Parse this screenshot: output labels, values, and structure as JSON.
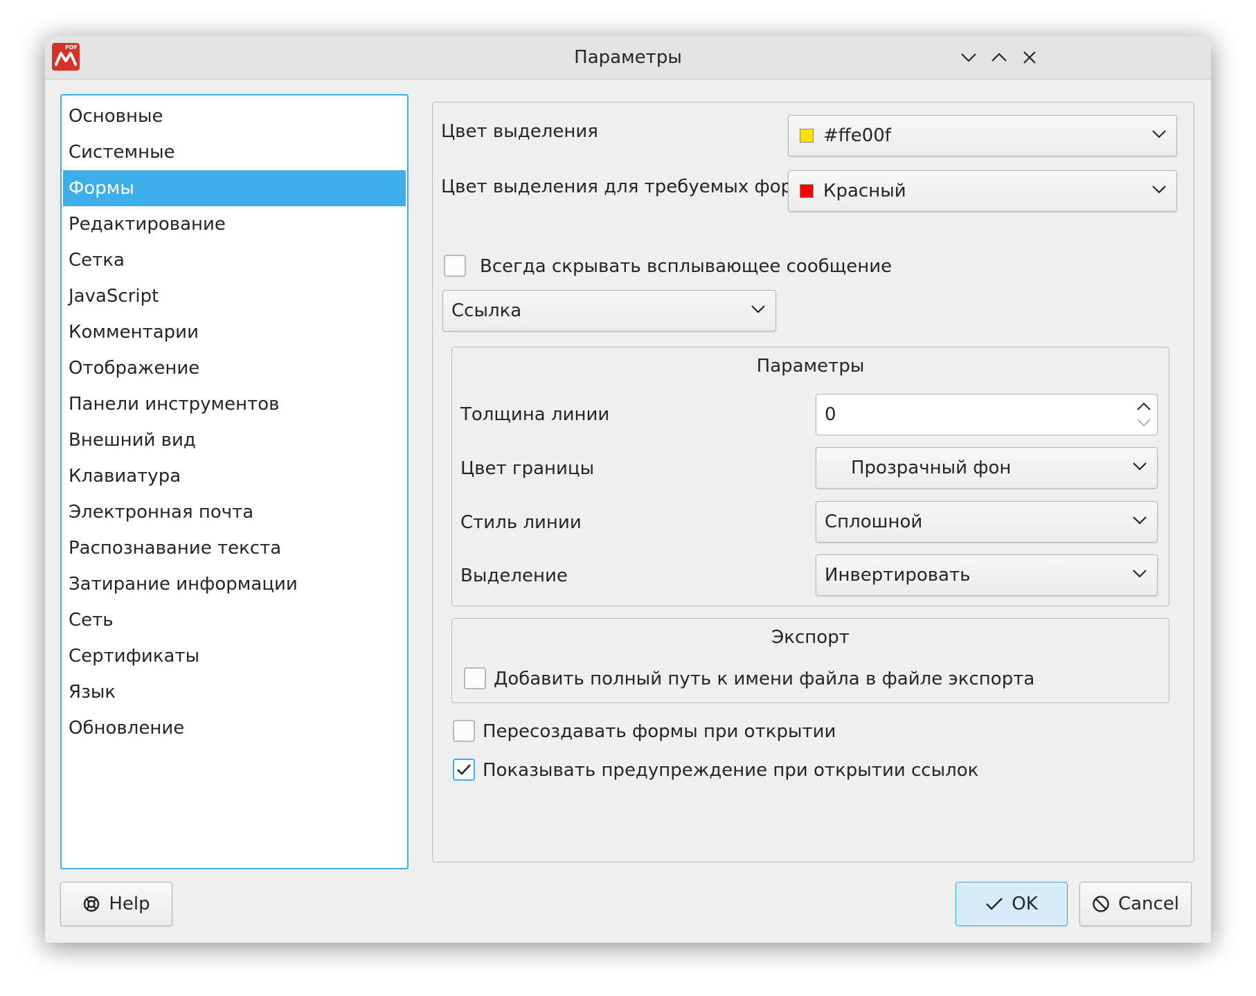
{
  "window": {
    "title": "Параметры"
  },
  "sidebar": {
    "items": [
      {
        "label": "Основные"
      },
      {
        "label": "Системные"
      },
      {
        "label": "Формы",
        "selected": true
      },
      {
        "label": "Редактирование"
      },
      {
        "label": "Сетка"
      },
      {
        "label": "JavaScript"
      },
      {
        "label": "Комментарии"
      },
      {
        "label": "Отображение"
      },
      {
        "label": "Панели инструментов"
      },
      {
        "label": "Внешний вид"
      },
      {
        "label": "Клавиатура"
      },
      {
        "label": "Электронная почта"
      },
      {
        "label": "Распознавание текста"
      },
      {
        "label": "Затирание информации"
      },
      {
        "label": "Сеть"
      },
      {
        "label": "Сертификаты"
      },
      {
        "label": "Язык"
      },
      {
        "label": "Обновление"
      }
    ]
  },
  "forms": {
    "highlight_color": {
      "label": "Цвет выделения",
      "value": "#ffe00f",
      "swatch": "#ffe00f"
    },
    "required_color": {
      "label": "Цвет выделения для требуемых форм",
      "value": "Красный",
      "swatch": "#ff0000"
    },
    "hide_popup": {
      "label": "Всегда скрывать всплывающее сообщение",
      "checked": false
    },
    "field_type": {
      "value": "Ссылка"
    },
    "params_group": {
      "title": "Параметры",
      "line_width": {
        "label": "Толщина линии",
        "value": "0"
      },
      "border_color": {
        "label": "Цвет границы",
        "value": "Прозрачный фон"
      },
      "line_style": {
        "label": "Стиль линии",
        "value": "Сплошной"
      },
      "highlight": {
        "label": "Выделение",
        "value": "Инвертировать"
      }
    },
    "export_group": {
      "title": "Экспорт",
      "add_path": {
        "label": "Добавить полный путь к имени файла в файле экспорта",
        "checked": false
      }
    },
    "recreate_forms": {
      "label": "Пересоздавать формы при открытии",
      "checked": false
    },
    "warn_links": {
      "label": "Показывать предупреждение при открытии ссылок",
      "checked": true
    }
  },
  "buttons": {
    "help": "Help",
    "ok": "OK",
    "cancel": "Cancel"
  },
  "colors": {
    "accent": "#3daee9"
  }
}
